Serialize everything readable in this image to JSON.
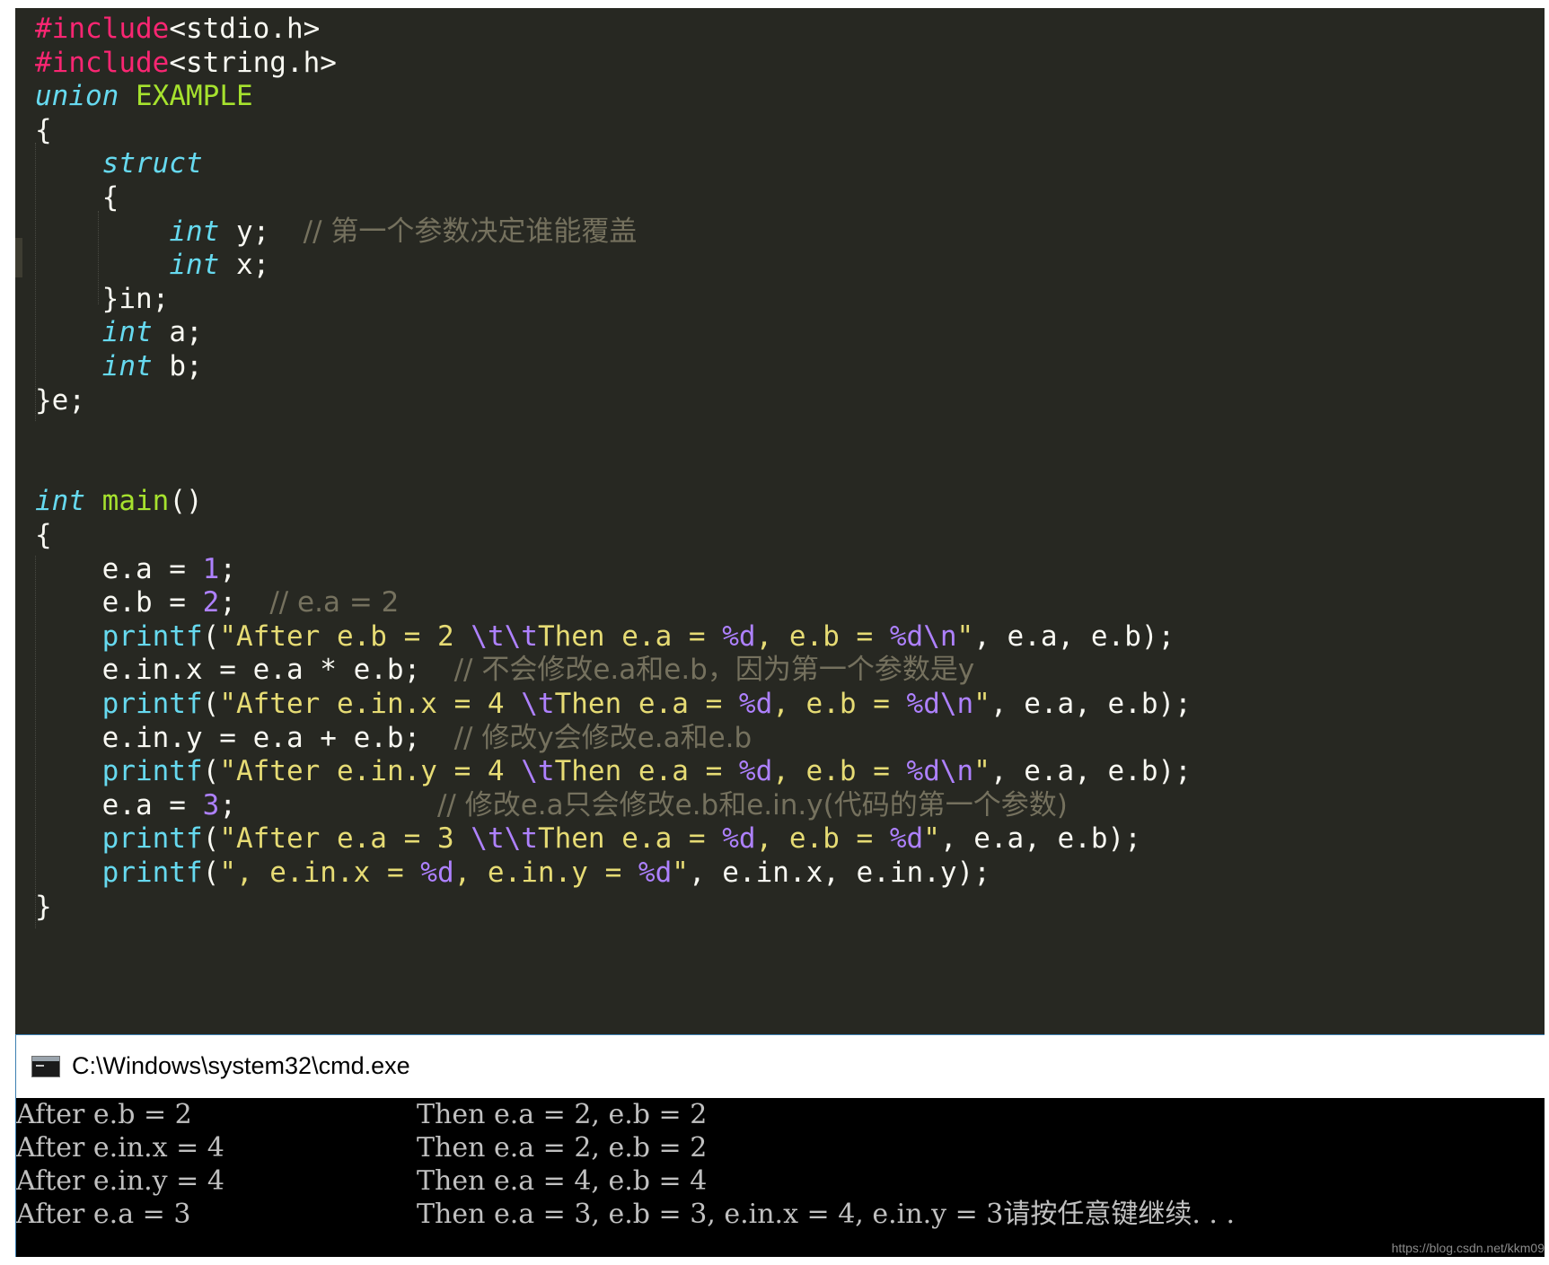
{
  "editor": {
    "theme_colors": {
      "background": "#272822",
      "default": "#f8f8f2",
      "keyword": "#66d9ef",
      "preprocessor": "#f92672",
      "class_name": "#a6e22e",
      "string": "#e6db74",
      "number": "#ae81ff",
      "comment": "#75715e"
    },
    "lines": [
      [
        {
          "t": "#include",
          "c": "pp"
        },
        {
          "t": "<stdio.h>",
          "c": "op"
        }
      ],
      [
        {
          "t": "#include",
          "c": "pp"
        },
        {
          "t": "<string.h>",
          "c": "op"
        }
      ],
      [
        {
          "t": "union",
          "c": "kw"
        },
        {
          "t": " ",
          "c": "op"
        },
        {
          "t": "EXAMPLE",
          "c": "cls"
        }
      ],
      [
        {
          "t": "{",
          "c": "op"
        }
      ],
      [
        {
          "t": "    ",
          "c": "op"
        },
        {
          "t": "struct",
          "c": "kw"
        }
      ],
      [
        {
          "t": "    {",
          "c": "op"
        }
      ],
      [
        {
          "t": "        ",
          "c": "op"
        },
        {
          "t": "int",
          "c": "kw"
        },
        {
          "t": " y;  ",
          "c": "op"
        },
        {
          "t": "// 第一个参数决定谁能覆盖",
          "c": "cmt"
        }
      ],
      [
        {
          "t": "        ",
          "c": "op"
        },
        {
          "t": "int",
          "c": "kw"
        },
        {
          "t": " x;",
          "c": "op"
        }
      ],
      [
        {
          "t": "    }in;",
          "c": "op"
        }
      ],
      [
        {
          "t": "    ",
          "c": "op"
        },
        {
          "t": "int",
          "c": "kw"
        },
        {
          "t": " a;",
          "c": "op"
        }
      ],
      [
        {
          "t": "    ",
          "c": "op"
        },
        {
          "t": "int",
          "c": "kw"
        },
        {
          "t": " b;",
          "c": "op"
        }
      ],
      [
        {
          "t": "}e;",
          "c": "op"
        }
      ],
      [],
      [],
      [
        {
          "t": "int",
          "c": "kw"
        },
        {
          "t": " ",
          "c": "op"
        },
        {
          "t": "main",
          "c": "fn2"
        },
        {
          "t": "()",
          "c": "op"
        }
      ],
      [
        {
          "t": "{",
          "c": "op"
        }
      ],
      [
        {
          "t": "    e.a = ",
          "c": "op"
        },
        {
          "t": "1",
          "c": "num"
        },
        {
          "t": ";",
          "c": "op"
        }
      ],
      [
        {
          "t": "    e.b = ",
          "c": "op"
        },
        {
          "t": "2",
          "c": "num"
        },
        {
          "t": ";  ",
          "c": "op"
        },
        {
          "t": "// e.a = 2",
          "c": "cmt"
        }
      ],
      [
        {
          "t": "    ",
          "c": "op"
        },
        {
          "t": "printf",
          "c": "fn"
        },
        {
          "t": "(",
          "c": "op"
        },
        {
          "t": "\"After e.b = 2 ",
          "c": "str"
        },
        {
          "t": "\\t\\t",
          "c": "esc"
        },
        {
          "t": "Then e.a = ",
          "c": "str"
        },
        {
          "t": "%d",
          "c": "esc"
        },
        {
          "t": ", e.b = ",
          "c": "str"
        },
        {
          "t": "%d\\n",
          "c": "esc"
        },
        {
          "t": "\"",
          "c": "str"
        },
        {
          "t": ", e.a, e.b);",
          "c": "op"
        }
      ],
      [
        {
          "t": "    e.in.x = e.a * e.b;  ",
          "c": "op"
        },
        {
          "t": "// 不会修改e.a和e.b，因为第一个参数是y",
          "c": "cmt"
        }
      ],
      [
        {
          "t": "    ",
          "c": "op"
        },
        {
          "t": "printf",
          "c": "fn"
        },
        {
          "t": "(",
          "c": "op"
        },
        {
          "t": "\"After e.in.x = 4 ",
          "c": "str"
        },
        {
          "t": "\\t",
          "c": "esc"
        },
        {
          "t": "Then e.a = ",
          "c": "str"
        },
        {
          "t": "%d",
          "c": "esc"
        },
        {
          "t": ", e.b = ",
          "c": "str"
        },
        {
          "t": "%d\\n",
          "c": "esc"
        },
        {
          "t": "\"",
          "c": "str"
        },
        {
          "t": ", e.a, e.b);",
          "c": "op"
        }
      ],
      [
        {
          "t": "    e.in.y = e.a + e.b;  ",
          "c": "op"
        },
        {
          "t": "// 修改y会修改e.a和e.b",
          "c": "cmt"
        }
      ],
      [
        {
          "t": "    ",
          "c": "op"
        },
        {
          "t": "printf",
          "c": "fn"
        },
        {
          "t": "(",
          "c": "op"
        },
        {
          "t": "\"After e.in.y = 4 ",
          "c": "str"
        },
        {
          "t": "\\t",
          "c": "esc"
        },
        {
          "t": "Then e.a = ",
          "c": "str"
        },
        {
          "t": "%d",
          "c": "esc"
        },
        {
          "t": ", e.b = ",
          "c": "str"
        },
        {
          "t": "%d\\n",
          "c": "esc"
        },
        {
          "t": "\"",
          "c": "str"
        },
        {
          "t": ", e.a, e.b);",
          "c": "op"
        }
      ],
      [
        {
          "t": "    e.a = ",
          "c": "op"
        },
        {
          "t": "3",
          "c": "num"
        },
        {
          "t": ";            ",
          "c": "op"
        },
        {
          "t": "// 修改e.a只会修改e.b和e.in.y(代码的第一个参数)",
          "c": "cmt"
        }
      ],
      [
        {
          "t": "    ",
          "c": "op"
        },
        {
          "t": "printf",
          "c": "fn"
        },
        {
          "t": "(",
          "c": "op"
        },
        {
          "t": "\"After e.a = 3 ",
          "c": "str"
        },
        {
          "t": "\\t\\t",
          "c": "esc"
        },
        {
          "t": "Then e.a = ",
          "c": "str"
        },
        {
          "t": "%d",
          "c": "esc"
        },
        {
          "t": ", e.b = ",
          "c": "str"
        },
        {
          "t": "%d",
          "c": "esc"
        },
        {
          "t": "\"",
          "c": "str"
        },
        {
          "t": ", e.a, e.b);",
          "c": "op"
        }
      ],
      [
        {
          "t": "    ",
          "c": "op"
        },
        {
          "t": "printf",
          "c": "fn"
        },
        {
          "t": "(",
          "c": "op"
        },
        {
          "t": "\", e.in.x = ",
          "c": "str"
        },
        {
          "t": "%d",
          "c": "esc"
        },
        {
          "t": ", e.in.y = ",
          "c": "str"
        },
        {
          "t": "%d",
          "c": "esc"
        },
        {
          "t": "\"",
          "c": "str"
        },
        {
          "t": ", e.in.x, e.in.y);",
          "c": "op"
        }
      ],
      [
        {
          "t": "}",
          "c": "op"
        }
      ]
    ]
  },
  "cmd": {
    "title": "C:\\Windows\\system32\\cmd.exe",
    "icon": "console-icon",
    "output": [
      {
        "left": "After e.b = 2",
        "right": "Then e.a = 2, e.b = 2"
      },
      {
        "left": "After e.in.x = 4",
        "right": "Then e.a = 2, e.b = 2"
      },
      {
        "left": "After e.in.y = 4",
        "right": "Then e.a = 4, e.b = 4"
      },
      {
        "left": "After e.a = 3",
        "right": "Then e.a = 3, e.b = 3, e.in.x = 4, e.in.y = 3请按任意键继续. . ."
      }
    ]
  },
  "watermark": "https://blog.csdn.net/kkm09"
}
